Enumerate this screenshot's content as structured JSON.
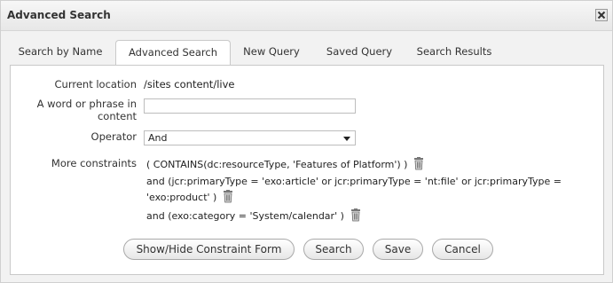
{
  "window": {
    "title": "Advanced Search"
  },
  "tabs": [
    {
      "label": "Search by Name"
    },
    {
      "label": "Advanced Search"
    },
    {
      "label": "New Query"
    },
    {
      "label": "Saved Query"
    },
    {
      "label": "Search Results"
    }
  ],
  "active_tab": "Advanced Search",
  "form": {
    "location_label": "Current location",
    "location_value": "/sites content/live",
    "phrase_label_line1": "A word or phrase in",
    "phrase_label_line2": "content",
    "phrase_value": "",
    "operator_label": "Operator",
    "operator_value": "And",
    "constraints_label": "More constraints",
    "constraints": [
      "( CONTAINS(dc:resourceType, 'Features of Platform') )",
      "and (jcr:primaryType = 'exo:article' or jcr:primaryType = 'nt:file' or jcr:primaryType =",
      "'exo:product' )",
      "and (exo:category = 'System/calendar' )"
    ]
  },
  "buttons": {
    "show_hide": "Show/Hide Constraint Form",
    "search": "Search",
    "save": "Save",
    "cancel": "Cancel"
  },
  "icons": {
    "close": "close-icon",
    "trash": "trash-icon"
  }
}
